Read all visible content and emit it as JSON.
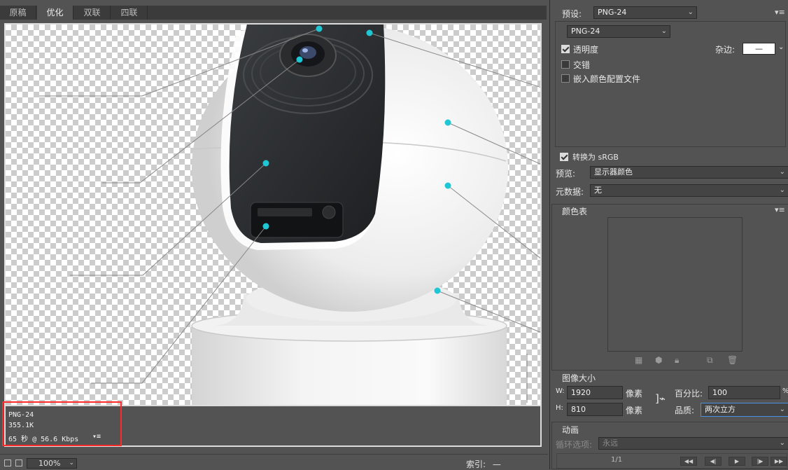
{
  "tabs": [
    {
      "label": "原稿"
    },
    {
      "label": "优化"
    },
    {
      "label": "双联"
    },
    {
      "label": "四联"
    }
  ],
  "active_tab": "优化",
  "info": {
    "format": "PNG-24",
    "size": "355.1K",
    "speed": "65 秒 @ 56.6 Kbps"
  },
  "statusbar": {
    "zoom": "100%",
    "index_label": "索引:",
    "index_value": "—"
  },
  "settings": {
    "preset_label": "预设:",
    "preset_value": "PNG-24",
    "format_value": "PNG-24",
    "transparency_label": "透明度",
    "transparency_checked": true,
    "matte_label": "杂边:",
    "matte_value": "—",
    "interlaced_label": "交错",
    "interlaced_checked": false,
    "embed_profile_label": "嵌入颜色配置文件",
    "embed_profile_checked": false,
    "srgb_label": "转换为 sRGB",
    "srgb_checked": true,
    "preview_label": "预览:",
    "preview_value": "显示器颜色",
    "metadata_label": "元数据:",
    "metadata_value": "无"
  },
  "color_table": {
    "title": "颜色表"
  },
  "image_size": {
    "title": "图像大小",
    "w_label": "W:",
    "w_value": "1920",
    "h_label": "H:",
    "h_value": "810",
    "unit": "像素",
    "percent_label": "百分比:",
    "percent_value": "100",
    "percent_unit": "%",
    "quality_label": "品质:",
    "quality_value": "两次立方"
  },
  "animation": {
    "title": "动画",
    "loop_label": "循环选项:",
    "loop_value": "永远",
    "frame_counter": "1/1"
  },
  "colors": {
    "accent_dot": "#1fc7d4",
    "highlight_box": "#ff2a2a",
    "panel_bg": "#535353"
  }
}
